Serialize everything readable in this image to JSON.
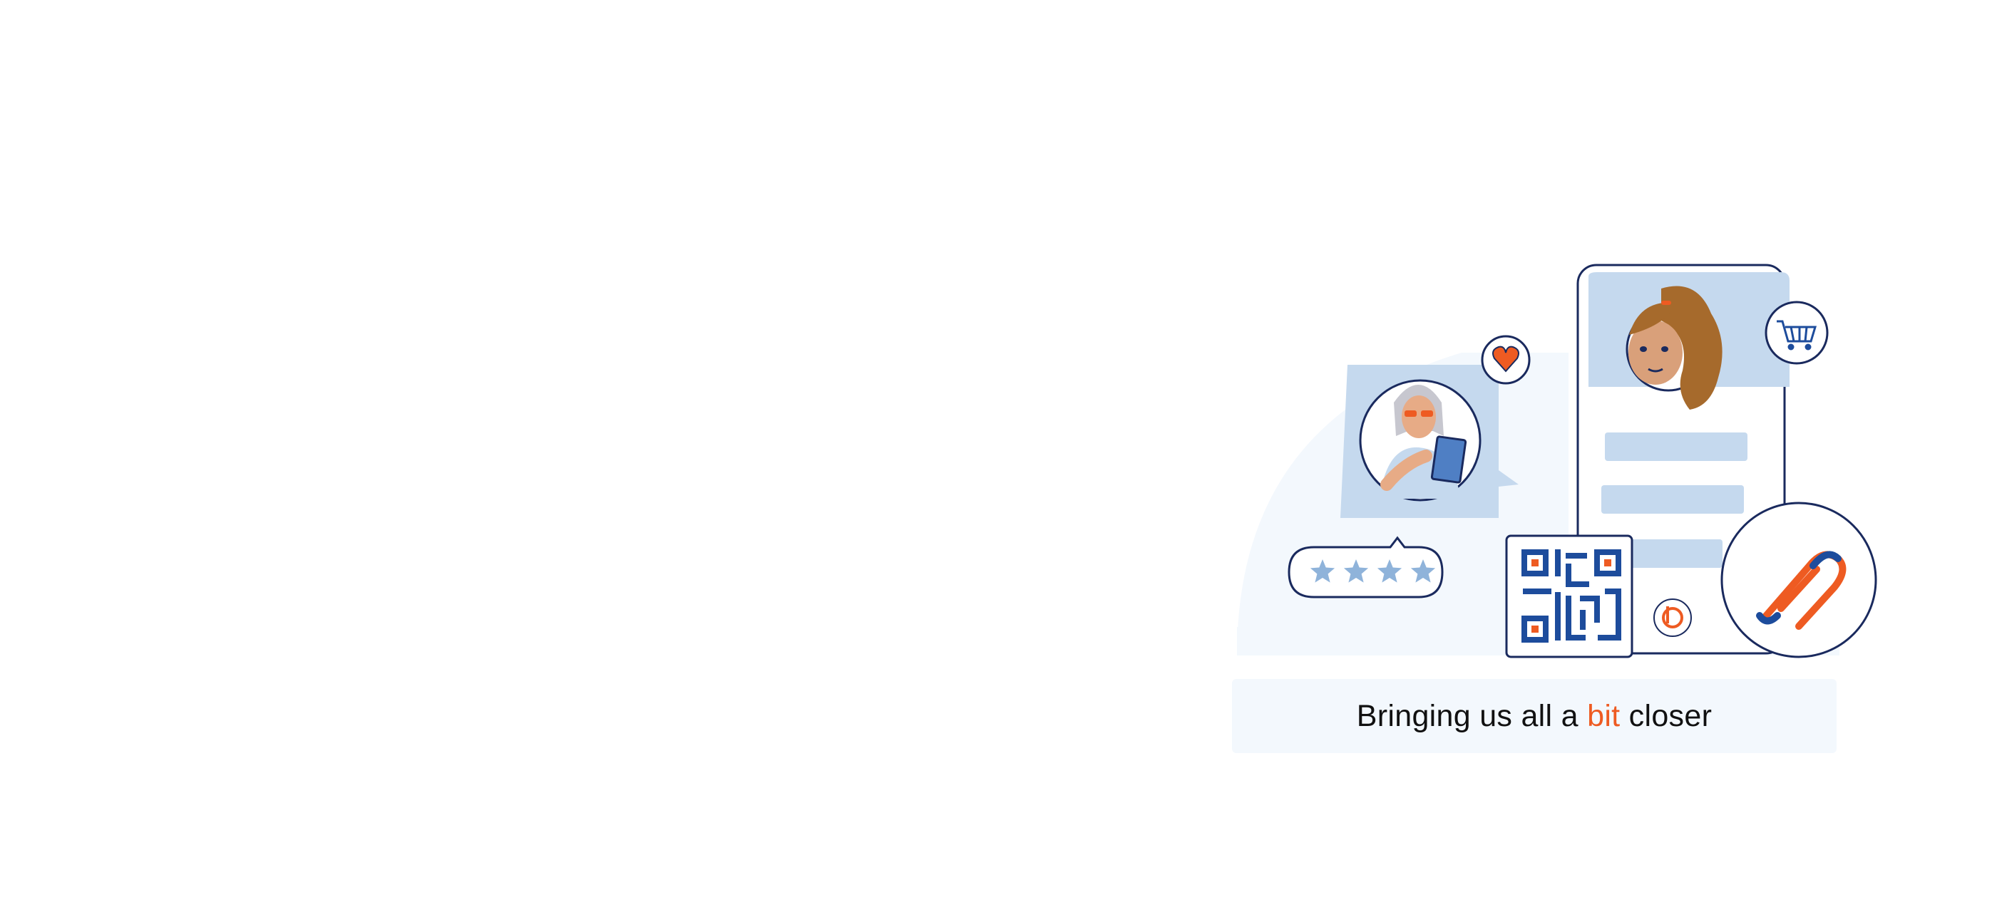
{
  "tagline": {
    "before": "Bringing us all a ",
    "accent": "bit",
    "after": " closer"
  },
  "colors": {
    "accent": "#ee5b22",
    "navy": "#1a2a5e",
    "light_blue": "#c5d9ee",
    "pale_blue": "#f3f8fd",
    "qr_blue": "#1d4c9c",
    "star_blue": "#8fb3da"
  },
  "rating": {
    "stars": 4
  },
  "icons": [
    "heart-icon",
    "cart-icon",
    "paperclip-link-icon",
    "qr-code-icon",
    "bitly-logo-icon",
    "star-icon"
  ]
}
